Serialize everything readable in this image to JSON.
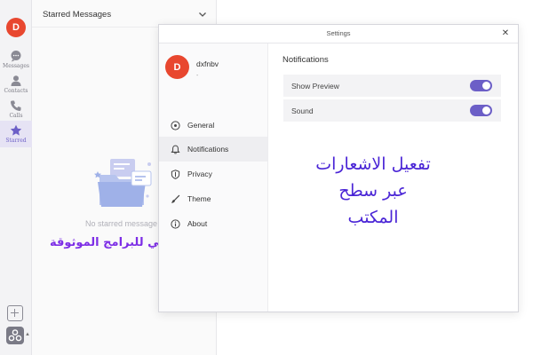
{
  "rail": {
    "avatar_letter": "D",
    "items": [
      {
        "label": "Messages",
        "icon": "chat-bubble-icon"
      },
      {
        "label": "Contacts",
        "icon": "person-icon"
      },
      {
        "label": "Calls",
        "icon": "phone-icon"
      },
      {
        "label": "Starred",
        "icon": "star-icon"
      }
    ],
    "active_item": "Starred",
    "bottom_icons": [
      "add-square-icon",
      "apps-icon"
    ]
  },
  "starred_panel": {
    "header": "Starred Messages",
    "empty_text": "No starred message"
  },
  "settings": {
    "title": "Settings",
    "close_symbol": "✕",
    "profile": {
      "avatar_letter": "D",
      "name": "dxfnbv",
      "status": "-"
    },
    "nav": [
      {
        "label": "General",
        "icon": "general-circle-icon"
      },
      {
        "label": "Notifications",
        "icon": "bell-icon"
      },
      {
        "label": "Privacy",
        "icon": "shield-icon"
      },
      {
        "label": "Theme",
        "icon": "brush-icon"
      },
      {
        "label": "About",
        "icon": "info-icon"
      }
    ],
    "active_nav": "Notifications",
    "content": {
      "title": "Notifications",
      "toggles": [
        {
          "label": "Show Preview",
          "on": true
        },
        {
          "label": "Sound",
          "on": true
        }
      ]
    }
  },
  "overlay_text": {
    "line_left": "العربي للبرامج الموثوقة",
    "line_right_1": "تفعيل الاشعارات",
    "line_right_2": "عبر سطح المكتب"
  },
  "colors": {
    "accent": "#6c5fc7",
    "avatar": "#e8472f",
    "overlay_purple": "#7d2ee6",
    "overlay_blue": "#4a25d6"
  }
}
